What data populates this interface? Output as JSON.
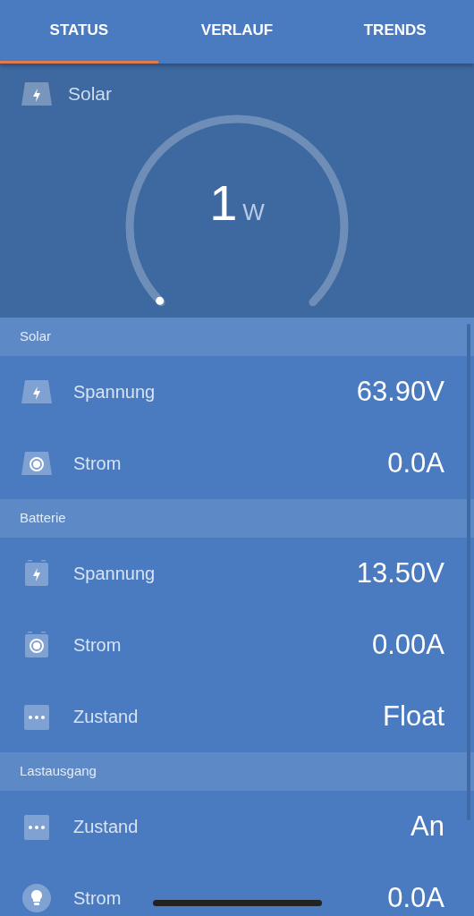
{
  "tabs": [
    {
      "label": "STATUS",
      "selected": true
    },
    {
      "label": "VERLAUF",
      "selected": false
    },
    {
      "label": "TRENDS",
      "selected": false
    }
  ],
  "gauge": {
    "title": "Solar",
    "value": "1",
    "unit": "W"
  },
  "sections": [
    {
      "title": "Solar",
      "kind": "solar",
      "rows": [
        {
          "kind": "voltage",
          "label": "Spannung",
          "value": "63.90V"
        },
        {
          "kind": "current",
          "label": "Strom",
          "value": "0.0A"
        }
      ]
    },
    {
      "title": "Batterie",
      "kind": "battery",
      "rows": [
        {
          "kind": "voltage",
          "label": "Spannung",
          "value": "13.50V"
        },
        {
          "kind": "current",
          "label": "Strom",
          "value": "0.00A"
        },
        {
          "kind": "state",
          "label": "Zustand",
          "value": "Float"
        }
      ]
    },
    {
      "title": "Lastausgang",
      "kind": "load",
      "rows": [
        {
          "kind": "state",
          "label": "Zustand",
          "value": "An"
        },
        {
          "kind": "current",
          "label": "Strom",
          "value": "0.0A"
        }
      ]
    }
  ]
}
